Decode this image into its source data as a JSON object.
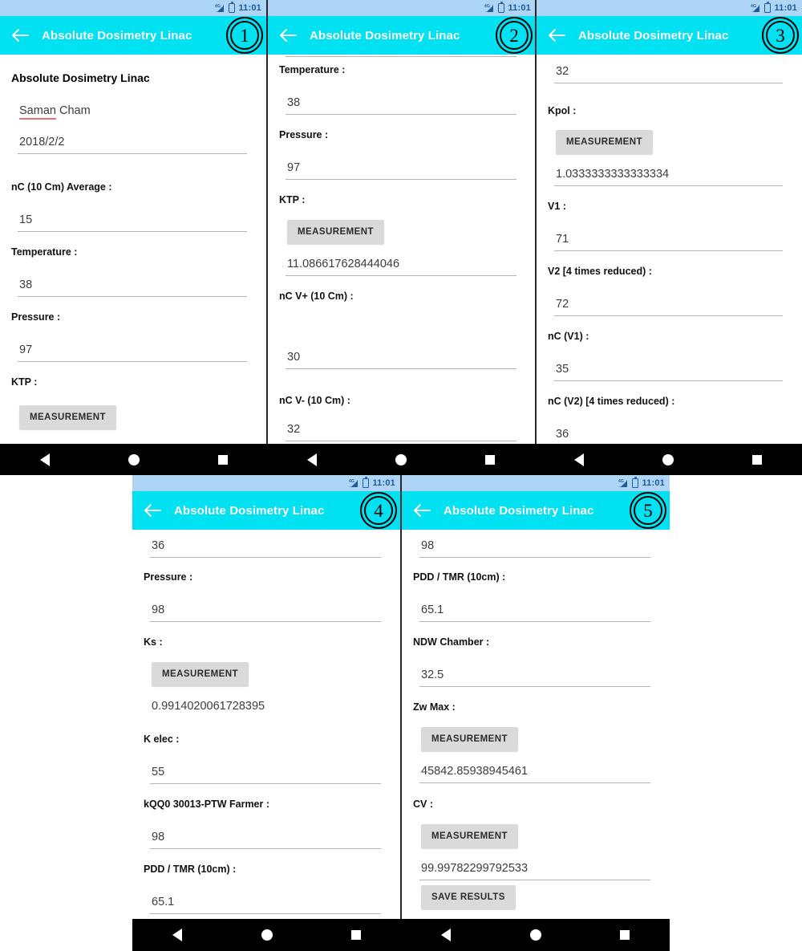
{
  "app": {
    "title": "Absolute Dosimetry Linac",
    "back_icon": "back-arrow-icon",
    "accent_color": "#00e2f2",
    "statusbar_color": "#aed5f5",
    "status": {
      "time": "11:01",
      "network": "4G",
      "signal_icon": "signal-icon",
      "battery_icon": "battery-icon"
    }
  },
  "nav": {
    "back_label": "back",
    "home_label": "home",
    "recents_label": "recents"
  },
  "labels": {
    "measurement": "MEASUREMENT",
    "save_results": "SAVE RESULTS"
  },
  "panels": [
    {
      "number": "1",
      "fields": [
        {
          "kind": "title",
          "text": "Absolute Dosimetry Linac"
        },
        {
          "kind": "plain",
          "text": "Saman Cham",
          "spell_word": "Saman",
          "rest": " Cham"
        },
        {
          "kind": "value",
          "value": "2018/2/2"
        },
        {
          "kind": "label",
          "text": "nC (10 Cm) Average :"
        },
        {
          "kind": "value",
          "value": "15"
        },
        {
          "kind": "label",
          "text": "Temperature :"
        },
        {
          "kind": "value",
          "value": "38"
        },
        {
          "kind": "label",
          "text": "Pressure :"
        },
        {
          "kind": "value",
          "value": "97"
        },
        {
          "kind": "label",
          "text": "KTP :"
        },
        {
          "kind": "button",
          "text": "MEASUREMENT"
        }
      ]
    },
    {
      "number": "2",
      "fields": [
        {
          "kind": "rule"
        },
        {
          "kind": "label",
          "text": "Temperature :"
        },
        {
          "kind": "value",
          "value": "38"
        },
        {
          "kind": "label",
          "text": "Pressure :"
        },
        {
          "kind": "value",
          "value": "97"
        },
        {
          "kind": "label",
          "text": "KTP :"
        },
        {
          "kind": "button",
          "text": "MEASUREMENT"
        },
        {
          "kind": "value",
          "value": "11.086617628444046"
        },
        {
          "kind": "label",
          "text": "nC  V+ (10 Cm) :"
        },
        {
          "kind": "value",
          "value": "30"
        },
        {
          "kind": "label",
          "text": "nC  V- (10 Cm) :"
        },
        {
          "kind": "value",
          "value": "32"
        }
      ]
    },
    {
      "number": "3",
      "fields": [
        {
          "kind": "value",
          "value": "32"
        },
        {
          "kind": "label",
          "text": "Kpol :"
        },
        {
          "kind": "button",
          "text": "MEASUREMENT"
        },
        {
          "kind": "value",
          "value": "1.0333333333333334"
        },
        {
          "kind": "label",
          "text": "V1 :"
        },
        {
          "kind": "value",
          "value": "71"
        },
        {
          "kind": "label",
          "text": "V2  [4 times reduced) :"
        },
        {
          "kind": "value",
          "value": "72"
        },
        {
          "kind": "label",
          "text": "nC (V1) :"
        },
        {
          "kind": "value",
          "value": "35"
        },
        {
          "kind": "label",
          "text": "nC (V2) [4 times reduced) :"
        },
        {
          "kind": "value",
          "value": "36"
        }
      ]
    },
    {
      "number": "4",
      "fields": [
        {
          "kind": "value",
          "value": "36"
        },
        {
          "kind": "label",
          "text": "Pressure :"
        },
        {
          "kind": "value",
          "value": "98"
        },
        {
          "kind": "label",
          "text": "Ks :"
        },
        {
          "kind": "button",
          "text": "MEASUREMENT"
        },
        {
          "kind": "value_noline",
          "value": "0.9914020061728395"
        },
        {
          "kind": "label",
          "text": "K elec :"
        },
        {
          "kind": "value",
          "value": "55"
        },
        {
          "kind": "label",
          "text": "kQQ0 30013-PTW Farmer :"
        },
        {
          "kind": "value",
          "value": "98"
        },
        {
          "kind": "label",
          "text": "PDD / TMR  (10cm) :"
        },
        {
          "kind": "value",
          "value": "65.1"
        }
      ]
    },
    {
      "number": "5",
      "fields": [
        {
          "kind": "value",
          "value": "98"
        },
        {
          "kind": "label",
          "text": "PDD / TMR  (10cm) :"
        },
        {
          "kind": "value",
          "value": "65.1"
        },
        {
          "kind": "label",
          "text": "NDW Chamber :"
        },
        {
          "kind": "value",
          "value": "32.5"
        },
        {
          "kind": "label",
          "text": "Zw Max :"
        },
        {
          "kind": "button",
          "text": "MEASUREMENT"
        },
        {
          "kind": "value",
          "value": "45842.85938945461"
        },
        {
          "kind": "label",
          "text": "CV :"
        },
        {
          "kind": "button",
          "text": "MEASUREMENT"
        },
        {
          "kind": "value",
          "value": "99.99782299792533"
        },
        {
          "kind": "button",
          "text": "SAVE RESULTS"
        }
      ]
    }
  ]
}
